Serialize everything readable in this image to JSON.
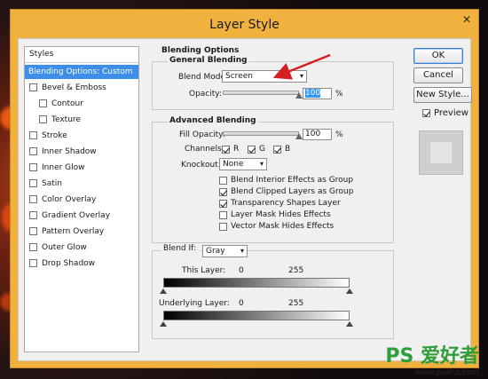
{
  "window": {
    "title": "Layer Style",
    "close_glyph": "✕"
  },
  "styles_panel": {
    "header": "Styles",
    "items": [
      {
        "label": "Blending Options: Custom",
        "selected": true,
        "checkbox": false
      },
      {
        "label": "Bevel & Emboss",
        "checkbox": true,
        "checked": false
      },
      {
        "label": "Contour",
        "checkbox": true,
        "checked": false,
        "indent": true
      },
      {
        "label": "Texture",
        "checkbox": true,
        "checked": false,
        "indent": true
      },
      {
        "label": "Stroke",
        "checkbox": true,
        "checked": false
      },
      {
        "label": "Inner Shadow",
        "checkbox": true,
        "checked": false
      },
      {
        "label": "Inner Glow",
        "checkbox": true,
        "checked": false
      },
      {
        "label": "Satin",
        "checkbox": true,
        "checked": false
      },
      {
        "label": "Color Overlay",
        "checkbox": true,
        "checked": false
      },
      {
        "label": "Gradient Overlay",
        "checkbox": true,
        "checked": false
      },
      {
        "label": "Pattern Overlay",
        "checkbox": true,
        "checked": false
      },
      {
        "label": "Outer Glow",
        "checkbox": true,
        "checked": false
      },
      {
        "label": "Drop Shadow",
        "checkbox": true,
        "checked": false
      }
    ]
  },
  "blending_options": {
    "title": "Blending Options",
    "general": {
      "title": "General Blending",
      "blend_mode_label": "Blend Mode:",
      "blend_mode_value": "Screen",
      "opacity_label": "Opacity:",
      "opacity_value": "100",
      "opacity_unit": "%",
      "opacity_fraction": 1.0
    },
    "advanced": {
      "title": "Advanced Blending",
      "fill_opacity_label": "Fill Opacity:",
      "fill_opacity_value": "100",
      "fill_opacity_unit": "%",
      "fill_opacity_fraction": 1.0,
      "channels_label": "Channels:",
      "channels": [
        {
          "label": "R",
          "checked": true
        },
        {
          "label": "G",
          "checked": true
        },
        {
          "label": "B",
          "checked": true
        }
      ],
      "knockout_label": "Knockout:",
      "knockout_value": "None",
      "options": [
        {
          "label": "Blend Interior Effects as Group",
          "checked": false
        },
        {
          "label": "Blend Clipped Layers as Group",
          "checked": true
        },
        {
          "label": "Transparency Shapes Layer",
          "checked": true
        },
        {
          "label": "Layer Mask Hides Effects",
          "checked": false
        },
        {
          "label": "Vector Mask Hides Effects",
          "checked": false
        }
      ]
    },
    "blend_if": {
      "label": "Blend If:",
      "value": "Gray",
      "this_layer_label": "This Layer:",
      "this_layer_min": "0",
      "this_layer_max": "255",
      "underlying_label": "Underlying Layer:",
      "underlying_min": "0",
      "underlying_max": "255"
    }
  },
  "buttons": {
    "ok": "OK",
    "cancel": "Cancel",
    "new_style": "New Style...",
    "preview_label": "Preview",
    "preview_checked": true
  },
  "annotation": {
    "arrow_color": "#d42020"
  },
  "watermark": {
    "main": "PS 爱好者",
    "sub": "www.psahz.com"
  },
  "colors": {
    "title_bar": "#f0b13f",
    "selection": "#3d8ee8",
    "watermark": "#2f9e3a"
  }
}
